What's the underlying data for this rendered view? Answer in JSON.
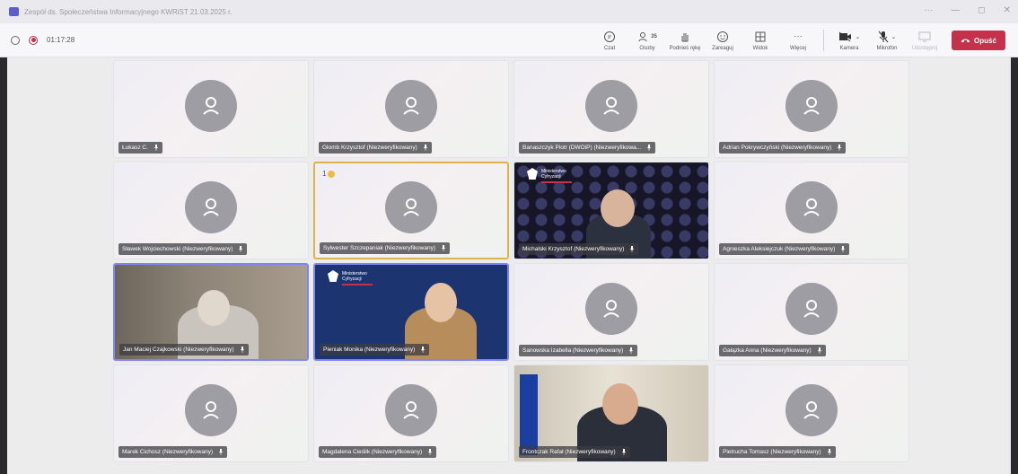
{
  "window": {
    "title": "Zespół ds. Społeczeństwa Informacyjnego KWRiST 21.03.2025 r."
  },
  "toolbar": {
    "timer": "01:17:28",
    "people_count": "35",
    "buttons": [
      {
        "key": "chat",
        "label": "Czat"
      },
      {
        "key": "people",
        "label": "Osoby"
      },
      {
        "key": "raise",
        "label": "Podnieś rękę"
      },
      {
        "key": "react",
        "label": "Zareaguj"
      },
      {
        "key": "view",
        "label": "Widok"
      },
      {
        "key": "more",
        "label": "Więcej"
      },
      {
        "key": "camera",
        "label": "Kamera"
      },
      {
        "key": "mic",
        "label": "Mikrofon"
      },
      {
        "key": "share",
        "label": "Udostępnij"
      }
    ],
    "leave_label": "Opuść"
  },
  "ministry": {
    "line1": "Ministerstwo",
    "line2": "Cyfryzacji"
  },
  "participants": [
    {
      "name": "Łukasz C.",
      "type": "avatar"
    },
    {
      "name": "Głomb Krzysztof (Niezweryfikowany)",
      "type": "avatar"
    },
    {
      "name": "Banaszczyk Piotr (DWOiP) (Niezweryfikowa...",
      "type": "avatar"
    },
    {
      "name": "Adrian Pokrywczyński (Niezweryfikowany)",
      "type": "avatar"
    },
    {
      "name": "Sławek Wojciechowski (Niezweryfikowany)",
      "type": "avatar"
    },
    {
      "name": "Sylwester Szczepaniak (Niezweryfikowany)",
      "type": "avatar",
      "raised_hand": "1"
    },
    {
      "name": "Michalski Krzysztof (Niezweryfikowany)",
      "type": "video"
    },
    {
      "name": "Agnieszka Aleksiejczuk (Niezweryfikowany)",
      "type": "avatar"
    },
    {
      "name": "Jan Maciej Czajkowski (Niezweryfikowany)",
      "type": "video"
    },
    {
      "name": "Pieniak Monika (Niezweryfikowany)",
      "type": "video"
    },
    {
      "name": "Sanowska Izabella (Niezweryfikowany)",
      "type": "avatar"
    },
    {
      "name": "Gałązka Anna (Niezweryfikowany)",
      "type": "avatar"
    },
    {
      "name": "Marek Cichosz (Niezweryfikowany)",
      "type": "avatar"
    },
    {
      "name": "Magdalena Cieślik (Niezweryfikowany)",
      "type": "avatar"
    },
    {
      "name": "Frontczak Rafał (Niezweryfikowany)",
      "type": "video"
    },
    {
      "name": "Pietrucha Tomasz (Niezweryfikowany)",
      "type": "avatar"
    }
  ]
}
